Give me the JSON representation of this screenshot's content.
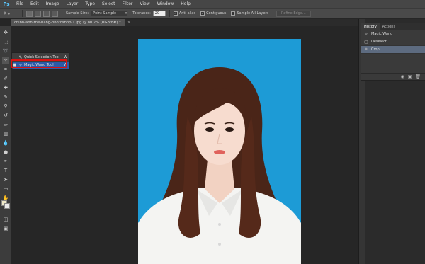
{
  "app": {
    "logo": "Ps"
  },
  "menu": [
    "File",
    "Edit",
    "Image",
    "Layer",
    "Type",
    "Select",
    "Filter",
    "View",
    "Window",
    "Help"
  ],
  "options": {
    "sample_size_label": "Sample Size:",
    "sample_size_value": "Point Sample",
    "tolerance_label": "Tolerance:",
    "tolerance_value": "20",
    "anti_alias_label": "Anti-alias",
    "contiguous_label": "Contiguous",
    "sample_all_layers_label": "Sample All Layers",
    "refine_edge_label": "Refine Edge..."
  },
  "document": {
    "tab_title": "chinh-anh-the-bang-photoshop-1.jpg @ 80.7% (RGB/8#) *",
    "close_glyph": "×"
  },
  "flyout": {
    "items": [
      {
        "label": "Quick Selection Tool",
        "key": "W",
        "icon": "quick-selection-icon",
        "glyph": "✎",
        "bullet": ""
      },
      {
        "label": "Magic Wand Tool",
        "key": "W",
        "icon": "magic-wand-icon",
        "glyph": "✧",
        "bullet": "■"
      }
    ]
  },
  "history_panel": {
    "tabs": [
      "History",
      "Actions"
    ],
    "items": [
      {
        "label": "Magic Wand",
        "icon": "magic-wand-icon",
        "glyph": "✧"
      },
      {
        "label": "Deselect",
        "icon": "deselect-icon",
        "glyph": "▢"
      },
      {
        "label": "Crop",
        "icon": "crop-icon",
        "glyph": "⌗"
      }
    ],
    "footer_icons": [
      "new-snapshot-icon",
      "new-document-icon",
      "trash-icon"
    ]
  },
  "colors": {
    "photo_background": "#1d9bd6",
    "highlight_border": "#dd1111",
    "ui_dark": "#262626"
  }
}
